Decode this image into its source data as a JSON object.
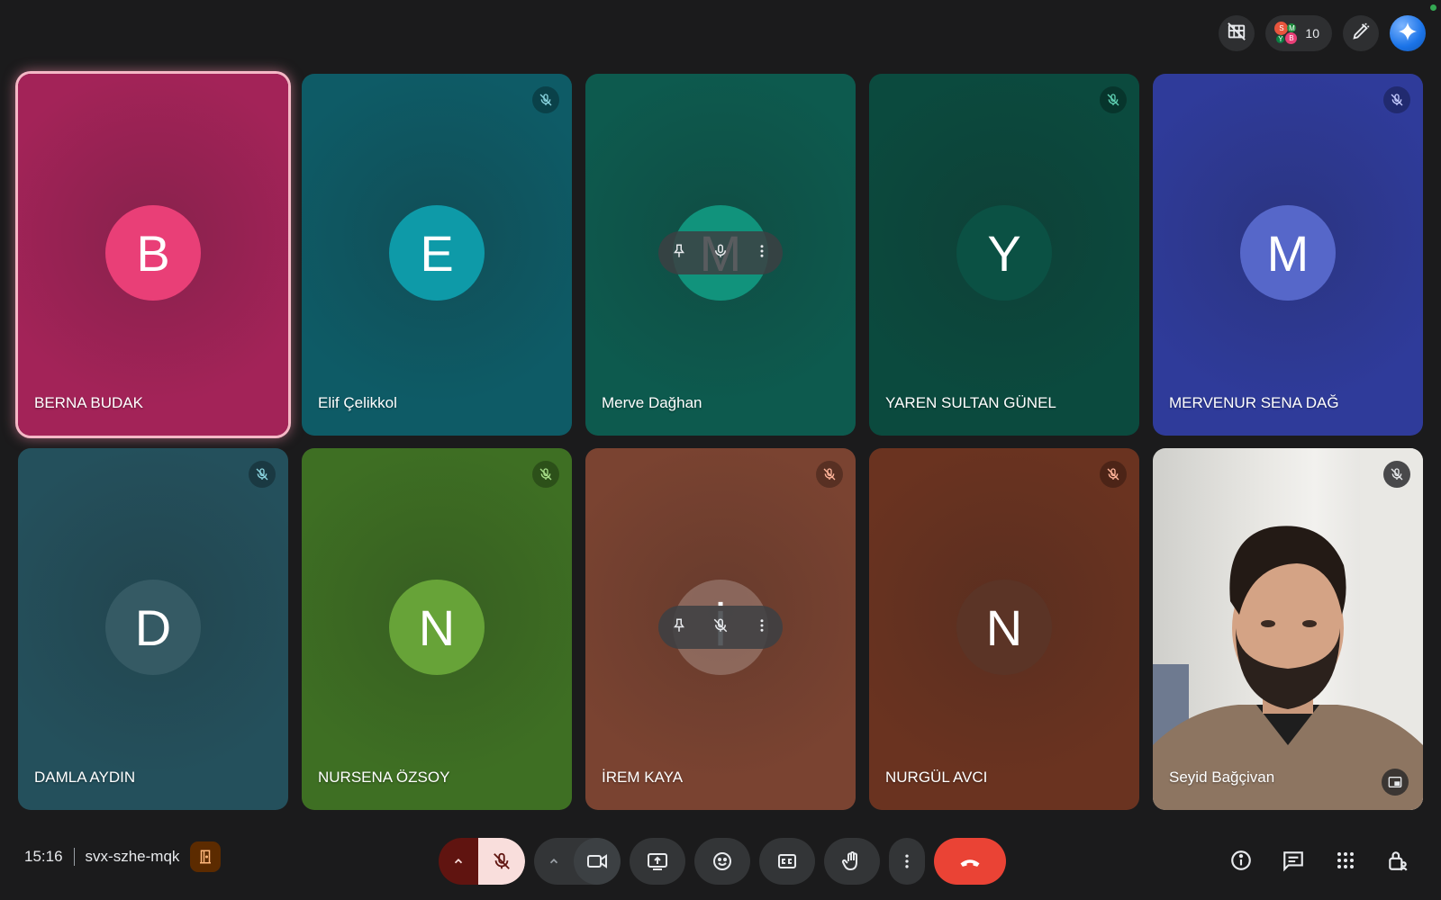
{
  "topbar": {
    "participant_count": "10",
    "mini_avatars": [
      "S",
      "M",
      "Y",
      "B"
    ],
    "icons": [
      "no-layout-icon",
      "people-icon",
      "edit-pen-icon",
      "gemini-icon"
    ]
  },
  "tiles": [
    {
      "name": "BERNA BUDAK",
      "initial": "B",
      "speaking": true,
      "muted": false,
      "bg": "#a32358",
      "avatar": "#e93f77"
    },
    {
      "name": "Elif Çelikkol",
      "initial": "E",
      "muted": true,
      "bg": "#0e5b66",
      "avatar": "#0e9aa8"
    },
    {
      "name": "Merve Dağhan",
      "initial": "M",
      "muted": false,
      "bg": "#0d5a4e",
      "avatar": "#11937c",
      "hover": true
    },
    {
      "name": "YAREN SULTAN GÜNEL",
      "initial": "Y",
      "muted": true,
      "bg": "#0b4a3e",
      "avatar": "#0b5144"
    },
    {
      "name": "MERVENUR SENA DAĞ",
      "initial": "M",
      "muted": true,
      "bg": "#2f3b9a",
      "avatar": "#5667c9"
    },
    {
      "name": "DAMLA AYDIN",
      "initial": "D",
      "muted": true,
      "bg": "#24505c",
      "avatar": "#355a64"
    },
    {
      "name": "NURSENA ÖZSOY",
      "initial": "N",
      "muted": true,
      "bg": "#3e6f23",
      "avatar": "#67a338"
    },
    {
      "name": "İREM KAYA",
      "initial": "İ",
      "muted": true,
      "bg": "#7a4331",
      "avatar": "#8c5440",
      "hover": true
    },
    {
      "name": "NURGÜL AVCI",
      "initial": "N",
      "muted": true,
      "bg": "#6a3320",
      "avatar": "#5b3426"
    },
    {
      "name": "Seyid Bağçivan",
      "initial": "",
      "muted": true,
      "video": true
    }
  ],
  "bottom": {
    "time": "15:16",
    "meeting_code": "svx-szhe-mqk"
  },
  "colors": {
    "background": "#1b1b1c",
    "end_call": "#ea4335",
    "mic_off": "#f9dedc",
    "mic_off_group": "#601410"
  }
}
